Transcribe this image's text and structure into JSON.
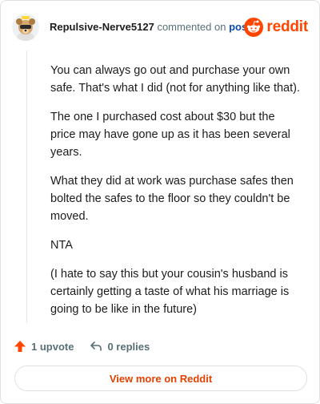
{
  "header": {
    "username": "Repulsive-Nerve5127",
    "action_text": "commented on",
    "post_link": "post",
    "brand_name": "reddit",
    "brand_color": "#ff4500"
  },
  "comment": {
    "paragraphs": [
      "You can always go out and purchase your own safe. That's what I did (not for anything like that).",
      "The one I purchased cost about $30 but the price may have gone up as it has been several years.",
      "What they did at work was purchase safes then bolted the safes to the floor so they couldn't be moved.",
      "NTA",
      "(I hate to say this but your cousin's husband is certainly getting a taste of what his marriage is going to be like in the future)"
    ]
  },
  "actions": {
    "upvote_label": "1 upvote",
    "replies_label": "0 replies",
    "upvote_icon": "upvote-arrow-icon",
    "reply_icon": "reply-arrow-icon"
  },
  "footer": {
    "view_more_label": "View more on Reddit"
  }
}
